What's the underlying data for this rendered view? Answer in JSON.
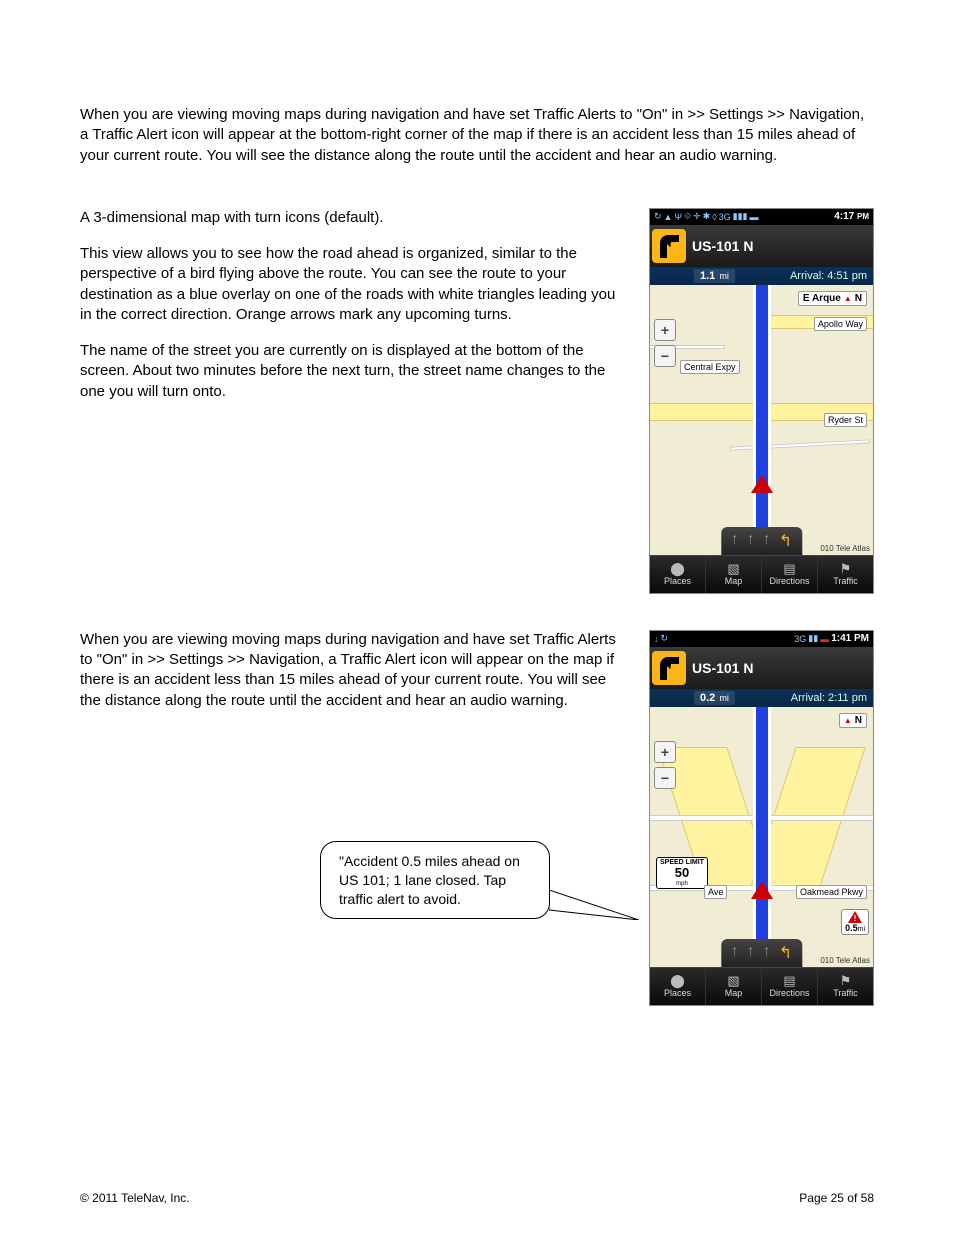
{
  "intro": "When you are viewing moving maps during navigation and have set Traffic Alerts to \"On\" in          >> Settings >> Navigation, a Traffic Alert icon will appear at the bottom-right corner of the map if there is an accident less than 15 miles ahead of your current route. You will see the distance along the route until the accident and hear an audio warning.",
  "section1": {
    "p1": "A 3-dimensional map with turn icons (default).",
    "p2": "This view allows you to see how the road ahead is organized, similar to the perspective of a bird flying above the route. You can see the route to your destination as a blue overlay on one of the roads with white triangles leading you in the correct direction. Orange arrows mark any upcoming turns.",
    "p3": "The name of the street you are currently on is displayed at the bottom of the screen. About two minutes before the next turn, the street name changes to the one you will turn onto."
  },
  "section2": {
    "p1": "When you are viewing moving maps during navigation and have set Traffic Alerts to \"On\" in              >> Settings >> Navigation, a Traffic Alert icon will appear on the map if there is an accident less than 15 miles ahead of your current route. You will see the distance along the route until the accident and hear an audio warning."
  },
  "callout": "\"Accident 0.5 miles ahead on US 101; 1 lane closed. Tap traffic alert to avoid.",
  "phone1": {
    "statusTime": "4:17",
    "statusPM": "PM",
    "road": "US-101 N",
    "distance": "1.1",
    "distUnit": "mi",
    "arrival": "Arrival: 4:51 pm",
    "compassPrefix": "E Arque",
    "compassN": "N",
    "labels": {
      "apollo": "Apollo Way",
      "central": "Central Expy",
      "ryder": "Ryder St"
    },
    "attribution": "010 Tele Atlas",
    "nav": [
      "Places",
      "Map",
      "Directions",
      "Traffic"
    ]
  },
  "phone2": {
    "statusTime": "1:41 PM",
    "road": "US-101 N",
    "distance": "0.2",
    "distUnit": "mi",
    "arrival": "Arrival: 2:11 pm",
    "compassN": "N",
    "speedLabel": "SPEED LIMIT",
    "speed": "50",
    "speedUnit": "mph",
    "labels": {
      "ave": "Ave",
      "oakmead": "Oakmead Pkwy"
    },
    "alertDist": "0.5",
    "alertUnit": "mi",
    "attribution": "010 Tele Atlas",
    "nav": [
      "Places",
      "Map",
      "Directions",
      "Traffic"
    ]
  },
  "footer": {
    "copyright": "© 2011 TeleNav, Inc.",
    "pagenum": "Page 25 of 58"
  }
}
